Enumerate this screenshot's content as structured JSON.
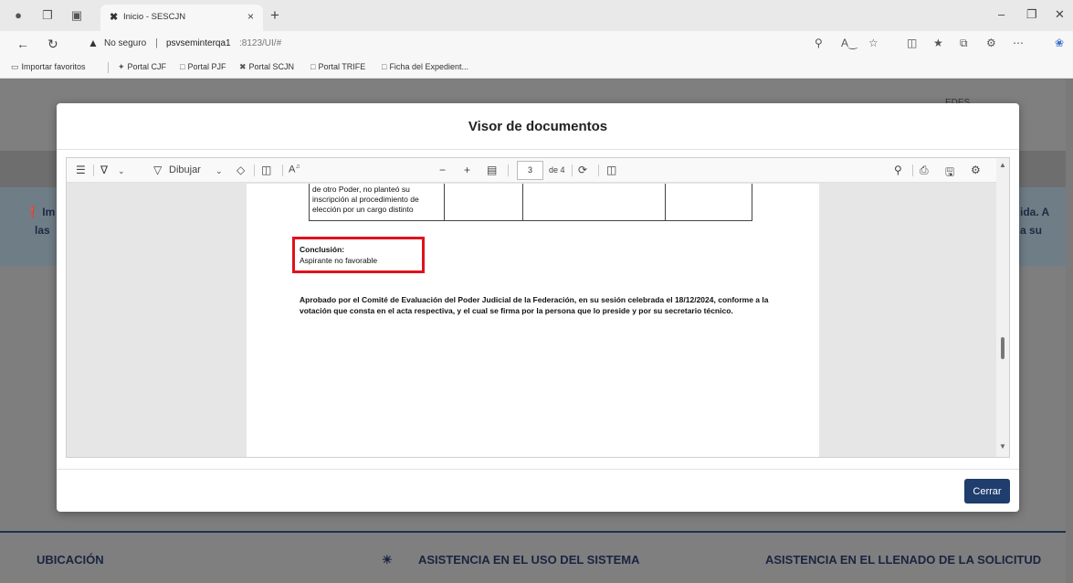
{
  "browser": {
    "tab_title": "Inicio - SESCJN",
    "tab_close": "×",
    "new_tab": "+",
    "security_label": "No seguro",
    "url_separator": "|",
    "url_host": "psvseminterqa1",
    "url_path": ":8123/UI/#",
    "bookmarks": [
      "Importar favoritos",
      "Portal CJF",
      "Portal PJF",
      "Portal SCJN",
      "Portal TRIFE",
      "Ficha del Expedient..."
    ]
  },
  "background_page": {
    "header_text": "EDES",
    "notice_left_1": "Im",
    "notice_left_2": "las",
    "notice_right_1": "ida. A",
    "notice_right_2": "a su",
    "footer_headings": [
      "UBICACIÓN",
      "ASISTENCIA EN EL USO DEL SISTEMA",
      "ASISTENCIA EN EL LLENADO DE LA SOLICITUD"
    ]
  },
  "modal": {
    "title": "Visor de documentos",
    "close_button": "Cerrar"
  },
  "viewer_toolbar": {
    "draw_label": "Dibujar",
    "text_size_label": "A",
    "zoom_out": "−",
    "zoom_in": "+",
    "page_current": "3",
    "page_total": "de 4"
  },
  "document": {
    "table_cell_text": "de otro Poder, no planteó su inscripción al procedimiento de elección por un cargo distinto",
    "conclusion_heading": "Conclusión:",
    "conclusion_value": "Aspirante no favorable",
    "approval_text": "Aprobado por el Comité de Evaluación del Poder Judicial de la Federación, en su sesión celebrada el 18/12/2024, conforme a la votación que consta en el acta respectiva, y el cual se firma por la persona que lo preside y por su secretario técnico."
  },
  "colors": {
    "highlight_border": "#e0121d",
    "close_button_bg": "#1f3d6d",
    "footer_line": "#1e3050"
  }
}
